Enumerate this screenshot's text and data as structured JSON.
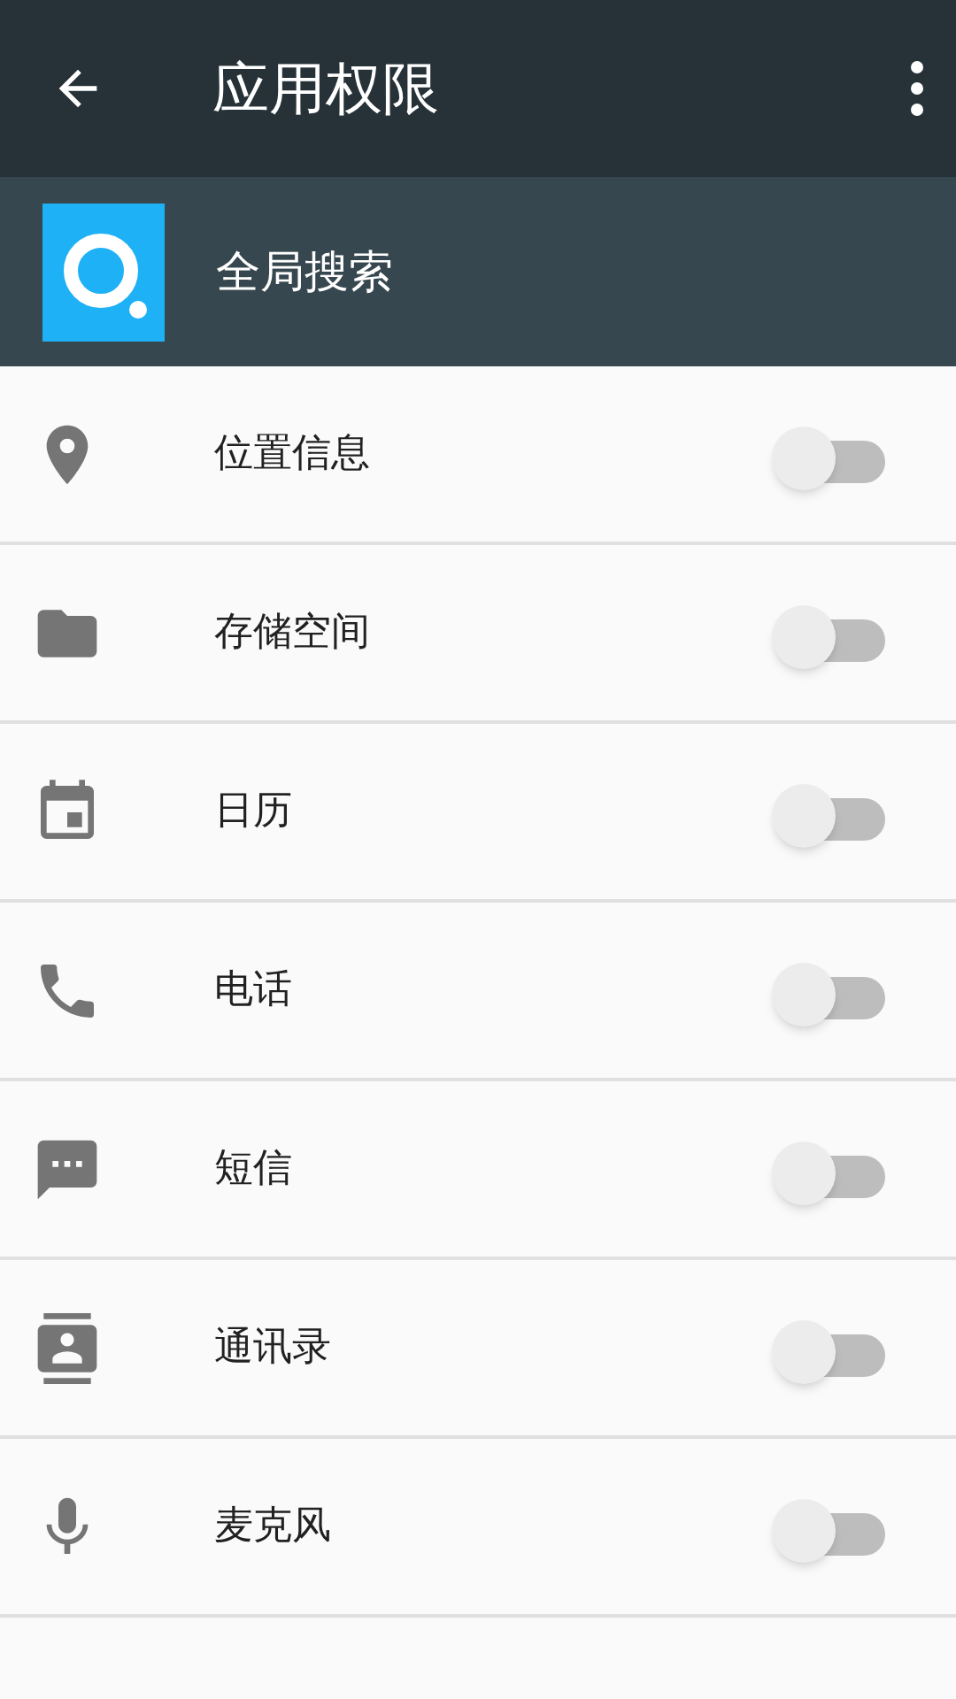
{
  "toolbar": {
    "title": "应用权限"
  },
  "app": {
    "name": "全局搜索"
  },
  "permissions": [
    {
      "kind": "location",
      "label": "位置信息",
      "checked": false
    },
    {
      "kind": "storage",
      "label": "存储空间",
      "checked": false
    },
    {
      "kind": "calendar",
      "label": "日历",
      "checked": false
    },
    {
      "kind": "phone",
      "label": "电话",
      "checked": false
    },
    {
      "kind": "sms",
      "label": "短信",
      "checked": false
    },
    {
      "kind": "contacts",
      "label": "通讯录",
      "checked": false
    },
    {
      "kind": "microphone",
      "label": "麦克风",
      "checked": false
    }
  ]
}
